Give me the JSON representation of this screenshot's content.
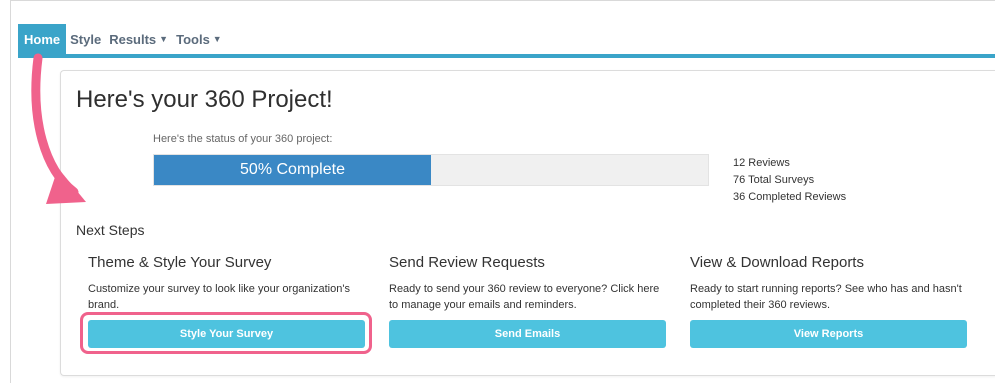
{
  "nav": {
    "items": [
      {
        "label": "Home",
        "active": true
      },
      {
        "label": "Style",
        "active": false
      },
      {
        "label": "Results",
        "active": false,
        "dropdown": true
      },
      {
        "label": "Tools",
        "active": false,
        "dropdown": true
      }
    ],
    "accent_color": "#3aa4c9"
  },
  "page": {
    "title": "Here's your 360 Project!",
    "status_label": "Here's the status of your 360 project:"
  },
  "progress": {
    "percent": 50,
    "label": "50% Complete",
    "fill_color": "#3a88c5"
  },
  "stats": {
    "reviews": "12 Reviews",
    "total_surveys": "76 Total Surveys",
    "completed_reviews": "36 Completed Reviews"
  },
  "next_steps": {
    "heading": "Next Steps",
    "steps": [
      {
        "title": "Theme & Style Your Survey",
        "description": "Customize your survey to look like your organization's brand.",
        "button": "Style Your Survey"
      },
      {
        "title": "Send Review Requests",
        "description": "Ready to send your 360 review to everyone? Click here to manage your emails and reminders.",
        "button": "Send Emails"
      },
      {
        "title": "View & Download Reports",
        "description": "Ready to start running reports? See who has and hasn't completed their 360 reviews.",
        "button": "View Reports"
      }
    ],
    "button_color": "#4ec3df"
  },
  "annotation": {
    "highlight_color": "#f0628c",
    "arrow_icon": "curved-arrow-icon"
  }
}
